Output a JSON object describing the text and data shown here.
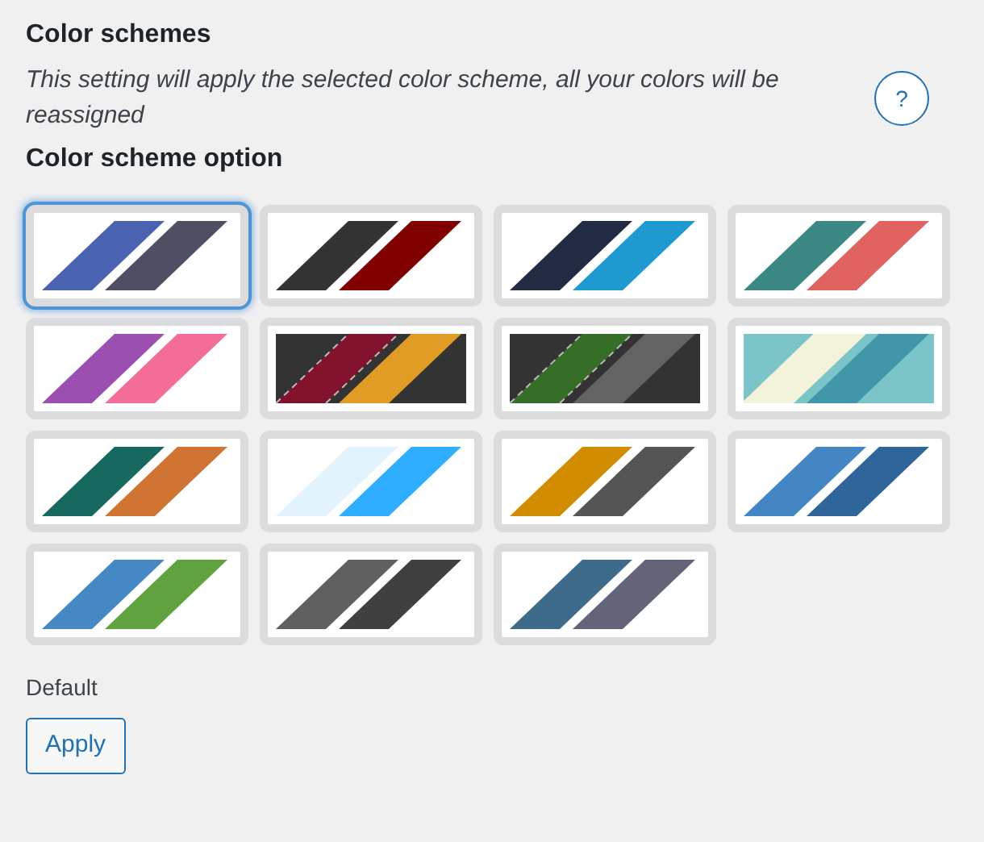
{
  "heading": "Color schemes",
  "description": "This setting will apply the selected color scheme, all your colors will be reassigned",
  "help_button": "?",
  "option_label": "Color scheme option",
  "schemes": [
    {
      "kind": "plain",
      "selected": true,
      "colors": [
        {
          "color": "#ffffff"
        },
        {
          "color": "#4a63b0"
        },
        {
          "color": "#4f4f63"
        }
      ]
    },
    {
      "kind": "plain",
      "selected": false,
      "colors": [
        {
          "color": "#ffffff"
        },
        {
          "color": "#333333"
        },
        {
          "color": "#800000"
        }
      ]
    },
    {
      "kind": "plain",
      "selected": false,
      "colors": [
        {
          "color": "#ffffff"
        },
        {
          "color": "#222b42"
        },
        {
          "color": "#1f9ad0"
        }
      ]
    },
    {
      "kind": "plain",
      "selected": false,
      "colors": [
        {
          "color": "#ffffff"
        },
        {
          "color": "#3a8783"
        },
        {
          "color": "#e06261"
        }
      ]
    },
    {
      "kind": "plain",
      "selected": false,
      "colors": [
        {
          "color": "#ffffff"
        },
        {
          "color": "#9b4fb1"
        },
        {
          "color": "#f36d97"
        }
      ]
    },
    {
      "kind": "dashed",
      "selected": false,
      "colors": [
        {
          "color": "#333333"
        },
        {
          "color": "#83122f"
        },
        {
          "color": "#e09c24"
        }
      ]
    },
    {
      "kind": "dashed",
      "selected": false,
      "colors": [
        {
          "color": "#333333"
        },
        {
          "color": "#376e27"
        },
        {
          "color": "#636363"
        }
      ]
    },
    {
      "kind": "wavy",
      "selected": false,
      "colors": [
        {
          "color": "#7bc5c8"
        },
        {
          "color": "#f3f3dc"
        },
        {
          "color": "#4196aa"
        }
      ]
    },
    {
      "kind": "plain",
      "selected": false,
      "colors": [
        {
          "color": "#ffffff"
        },
        {
          "color": "#17695f"
        },
        {
          "color": "#d07433"
        }
      ]
    },
    {
      "kind": "plain",
      "selected": false,
      "colors": [
        {
          "color": "#ffffff"
        },
        {
          "color": "#e3f3fe"
        },
        {
          "color": "#2faeff"
        }
      ]
    },
    {
      "kind": "plain",
      "selected": false,
      "colors": [
        {
          "color": "#ffffff"
        },
        {
          "color": "#d28c00"
        },
        {
          "color": "#555555"
        }
      ]
    },
    {
      "kind": "plain",
      "selected": false,
      "colors": [
        {
          "color": "#ffffff"
        },
        {
          "color": "#4485c4"
        },
        {
          "color": "#2f6598"
        }
      ]
    },
    {
      "kind": "plain",
      "selected": false,
      "colors": [
        {
          "color": "#ffffff"
        },
        {
          "color": "#4688c4"
        },
        {
          "color": "#5fa23f"
        }
      ]
    },
    {
      "kind": "plain",
      "selected": false,
      "colors": [
        {
          "color": "#ffffff"
        },
        {
          "color": "#606060"
        },
        {
          "color": "#404040"
        }
      ]
    },
    {
      "kind": "plain",
      "selected": false,
      "colors": [
        {
          "color": "#ffffff"
        },
        {
          "color": "#3f6b8b"
        },
        {
          "color": "#646479"
        }
      ]
    }
  ],
  "selected_name": "Default",
  "apply_button": "Apply"
}
